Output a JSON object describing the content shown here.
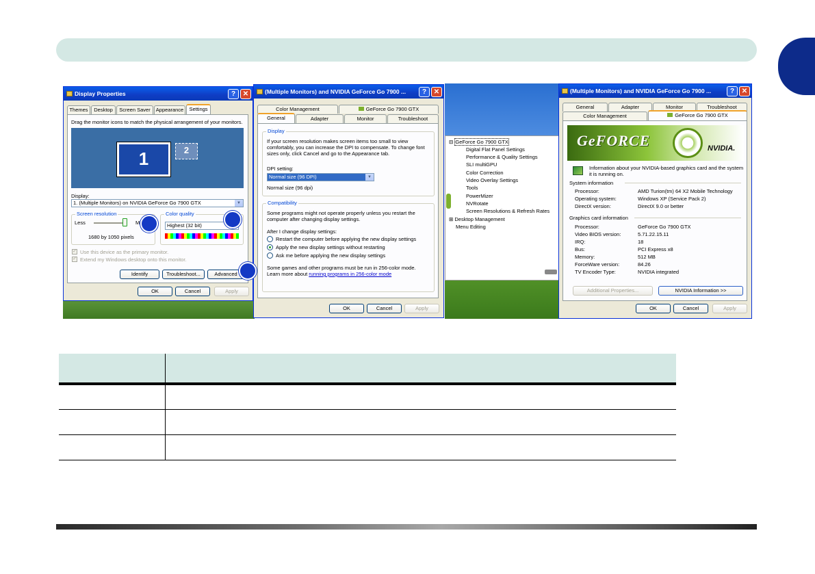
{
  "window1": {
    "title": "Display Properties",
    "tabs": [
      "Themes",
      "Desktop",
      "Screen Saver",
      "Appearance",
      "Settings"
    ],
    "instruction": "Drag the monitor icons to match the physical arrangement of your monitors.",
    "monitor_primary": "1",
    "monitor_secondary": "2",
    "display_label": "Display:",
    "display_value": "1. (Multiple Monitors) on NVIDIA GeForce Go 7900 GTX",
    "resolution_group": "Screen resolution",
    "less_label": "Less",
    "more_label": "M",
    "resolution_value": "1680 by 1050 pixels",
    "color_group": "Color quality",
    "color_value": "Highest (32 bit)",
    "primary_monitor_chk": "Use this device as the primary monitor.",
    "extend_chk": "Extend my Windows desktop onto this monitor.",
    "identify_button": "Identify",
    "troubleshoot_button": "Troubleshoot...",
    "advanced_button": "Advanced",
    "ok_button": "OK",
    "cancel_button": "Cancel",
    "apply_button": "Apply"
  },
  "window2": {
    "title": "(Multiple Monitors) and NVIDIA GeForce Go 7900 ...",
    "tabs_row1": [
      "Color Management",
      "GeForce Go 7900 GTX"
    ],
    "tabs_row2": [
      "General",
      "Adapter",
      "Monitor",
      "Troubleshoot"
    ],
    "display_group": "Display",
    "display_text": "If your screen resolution makes screen items too small to view comfortably, you can increase the DPI to compensate. To change font sizes only, click Cancel and go to the Appearance tab.",
    "dpi_label": "DPI setting:",
    "dpi_value": "Normal size (96 DPI)",
    "dpi_note": "Normal size (96 dpi)",
    "compat_group": "Compatibility",
    "compat_text": "Some programs might not operate properly unless you restart the computer after changing display settings.",
    "after_label": "After I change display settings:",
    "options": [
      "Restart the computer before applying the new display settings",
      "Apply the new display settings without restarting",
      "Ask me before applying the new display settings"
    ],
    "games_text": "Some games and other programs must be run in 256-color mode.",
    "learn_prefix": "Learn more about ",
    "learn_link": "running programs in 256-color mode",
    "ok_button": "OK",
    "cancel_button": "Cancel",
    "apply_button": "Apply"
  },
  "menu": {
    "root": "GeForce Go 7900 GTX",
    "items": [
      "Digital Flat Panel Settings",
      "Performance & Quality Settings",
      "SLI multiGPU",
      "Color Correction",
      "Video Overlay Settings",
      "Tools",
      "PowerMizer",
      "NVRotate",
      "Screen Resolutions & Refresh Rates"
    ],
    "desktop_mgmt": "Desktop Management",
    "menu_editing": "Menu Editing"
  },
  "window3": {
    "title": "(Multiple Monitors) and NVIDIA GeForce Go 7900 ...",
    "tabs_row1": [
      "General",
      "Adapter",
      "Monitor",
      "Troubleshoot"
    ],
    "tabs_row2": [
      "Color Management",
      "GeForce Go 7900 GTX"
    ],
    "banner_left": "GeFORCE",
    "banner_right": "NVIDIA.",
    "info_text": "Information about your NVIDIA-based graphics card and the system it is running on.",
    "sys_header": "System information",
    "sys_rows": [
      {
        "label": "Processor:",
        "value": "AMD Turion(tm) 64 X2 Mobile Technology"
      },
      {
        "label": "Operating system:",
        "value": "Windows XP (Service Pack 2)"
      },
      {
        "label": "DirectX version:",
        "value": "DirectX 9.0 or better"
      }
    ],
    "gfx_header": "Graphics card information",
    "gfx_rows": [
      {
        "label": "Processor:",
        "value": "GeForce Go 7900 GTX"
      },
      {
        "label": "Video BIOS version:",
        "value": "5.71.22.15.11"
      },
      {
        "label": "IRQ:",
        "value": "18"
      },
      {
        "label": "Bus:",
        "value": "PCI Express x8"
      },
      {
        "label": "Memory:",
        "value": "512 MB"
      },
      {
        "label": "ForceWare version:",
        "value": "84.26"
      },
      {
        "label": "TV Encoder Type:",
        "value": "NVIDIA integrated"
      }
    ],
    "additional_button": "Additional Properties...",
    "nvidia_info_button": "NVIDIA Information >>",
    "ok_button": "OK",
    "cancel_button": "Cancel",
    "apply_button": "Apply"
  },
  "colors": {
    "header_bar": "#d4e8e4",
    "chapter_tab": "#0d2b8a",
    "callout": "#1439c4",
    "xp_title": "#0a5eea"
  }
}
